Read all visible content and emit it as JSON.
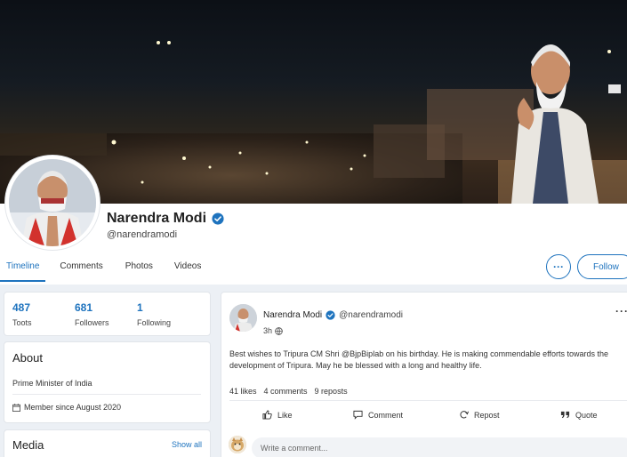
{
  "profile": {
    "name": "Narendra Modi",
    "handle": "@narendramodi"
  },
  "tabs": [
    {
      "label": "Timeline",
      "active": true
    },
    {
      "label": "Comments"
    },
    {
      "label": "Photos"
    },
    {
      "label": "Videos"
    }
  ],
  "actions": {
    "more": "···",
    "follow": "Follow"
  },
  "stats": [
    {
      "value": "487",
      "label": "Toots"
    },
    {
      "value": "681",
      "label": "Followers"
    },
    {
      "value": "1",
      "label": "Following"
    }
  ],
  "about": {
    "heading": "About",
    "title": "Prime Minister of India",
    "member_since": "Member since August 2020"
  },
  "media": {
    "heading": "Media",
    "show_all": "Show all"
  },
  "post": {
    "author": "Narendra Modi",
    "handle": "@narendramodi",
    "time": "3h",
    "menu": "···",
    "text": "Best wishes to Tripura CM Shri @BjpBiplab on his birthday. He is making commendable efforts towards the development of Tripura. May he be blessed with a long and healthy life.",
    "likes": "41 likes",
    "comments": "4 comments",
    "reposts": "9 reposts",
    "buttons": {
      "like": "Like",
      "comment": "Comment",
      "repost": "Repost",
      "quote": "Quote"
    },
    "comment_placeholder": "Write a comment..."
  },
  "colors": {
    "accent": "#1e73be",
    "background": "#ecf0f5"
  }
}
